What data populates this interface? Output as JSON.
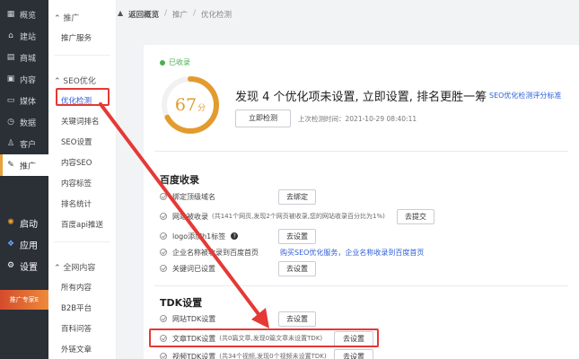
{
  "rail": {
    "items": [
      {
        "icon": "▦",
        "label": "概览"
      },
      {
        "icon": "⌂",
        "label": "建站"
      },
      {
        "icon": "▤",
        "label": "商城"
      },
      {
        "icon": "▣",
        "label": "内容"
      },
      {
        "icon": "▭",
        "label": "媒体"
      },
      {
        "icon": "◷",
        "label": "数据"
      },
      {
        "icon": "♙",
        "label": "客户"
      },
      {
        "icon": "✎",
        "label": "推广"
      }
    ],
    "extra": [
      {
        "icon": "✺",
        "label": "启动"
      },
      {
        "icon": "❖",
        "label": "应用"
      },
      {
        "icon": "⚙",
        "label": "设置"
      }
    ],
    "banner": "推广专家E"
  },
  "sidebar": {
    "group1": "推广",
    "group1_items": [
      "推广服务"
    ],
    "group2": "SEO优化",
    "group2_items": [
      "优化检测",
      "关键词排名",
      "SEO设置",
      "内容SEO",
      "内容标签",
      "排名统计",
      "百度api推送"
    ],
    "group3": "全网内容",
    "group3_items": [
      "所有内容",
      "B2B平台",
      "百科问答",
      "外链文章"
    ]
  },
  "breadcrumb": {
    "home": "返回概览",
    "sep": "/",
    "level1": "推广",
    "level2": "优化检测"
  },
  "summary": {
    "status": "已收录",
    "score_value": "67",
    "score_unit": "分",
    "score_fraction": 0.67,
    "headline": "发现 4 个优化项未设置, 立即设置, 排名更胜一筹",
    "standard_link": "SEO优化检测评分标准",
    "check_now": "立即检测",
    "last_check": "上次检测时间：2021-10-29 08:40:11"
  },
  "baidu": {
    "title": "百度收录",
    "rows": [
      {
        "label": "绑定顶级域名",
        "note": "",
        "action": "去绑定"
      },
      {
        "label": "网站被收录",
        "note": "(共141个网页,发现2个网页被收录,您的网站收录百分比为1%)",
        "action": "去提交"
      },
      {
        "label": "logo添加h1标签",
        "note": "",
        "action": "去设置"
      },
      {
        "label": "企业名称被收录到百度首页",
        "note": "",
        "promo": "购买SEO优化服务，企业名称收录到百度首页"
      },
      {
        "label": "关键词已设置",
        "note": "",
        "action": "去设置"
      }
    ]
  },
  "tdk": {
    "title": "TDK设置",
    "rows": [
      {
        "label": "网站TDK设置",
        "note": "",
        "action": "去设置"
      },
      {
        "label": "文章TDK设置",
        "note": "(共0篇文章,发现0篇文章未设置TDK)",
        "action": "去设置"
      },
      {
        "label": "视频TDK设置",
        "note": "(共34个视频,发现0个视频未设置TDK)",
        "action": "去设置"
      }
    ]
  },
  "colors": {
    "accent": "#e39b2e",
    "link": "#2f5fd8",
    "highlight": "#e53935",
    "ok": "#4caf50"
  }
}
